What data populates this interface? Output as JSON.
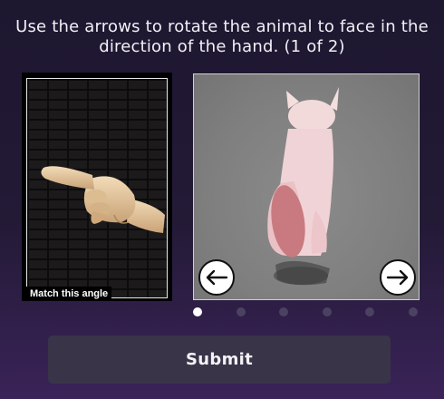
{
  "instruction": {
    "line1": "Use the arrows to rotate the animal to face in the",
    "line2": "direction of the hand. (1 of 2)"
  },
  "reference": {
    "caption": "Match this angle",
    "subject": "wooden hand pointing left"
  },
  "viewer": {
    "subject": "white cat model seen from behind",
    "rotate_left_icon": "arrow-left-icon",
    "rotate_right_icon": "arrow-right-icon"
  },
  "pagination": {
    "count": 6,
    "active_index": 0
  },
  "submit": {
    "label": "Submit"
  },
  "colors": {
    "background": "#231a36",
    "button": "#3a3449",
    "dot_inactive": "#4a4260",
    "dot_active": "#ffffff"
  }
}
